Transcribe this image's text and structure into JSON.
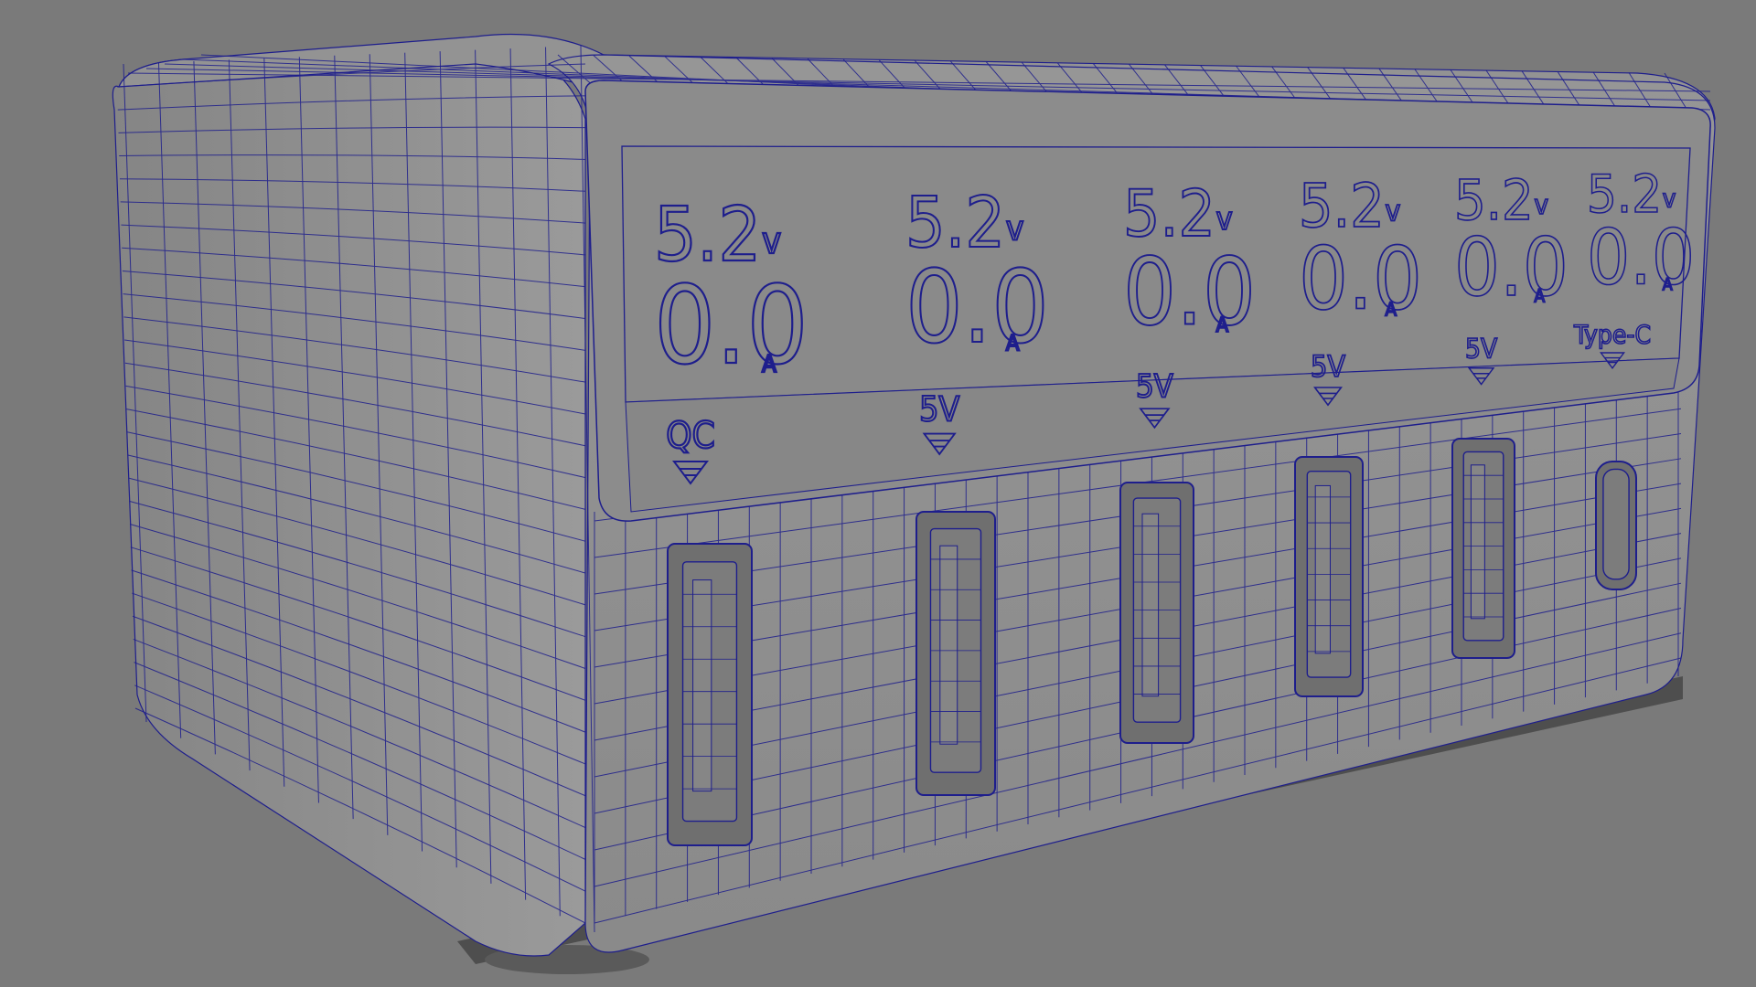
{
  "colors": {
    "background": "#7a7a7a",
    "body": "#8f8f8f",
    "wire": "#1e1e8c",
    "display": "#8a8a8a",
    "port": "#6f6f6f"
  },
  "channels": [
    {
      "voltage": "5.2",
      "voltage_unit": "v",
      "current": "0.0",
      "current_unit": "A",
      "label": "QC"
    },
    {
      "voltage": "5.2",
      "voltage_unit": "v",
      "current": "0.0",
      "current_unit": "A",
      "label": "5V"
    },
    {
      "voltage": "5.2",
      "voltage_unit": "v",
      "current": "0.0",
      "current_unit": "A",
      "label": "5V"
    },
    {
      "voltage": "5.2",
      "voltage_unit": "v",
      "current": "0.0",
      "current_unit": "A",
      "label": "5V"
    },
    {
      "voltage": "5.2",
      "voltage_unit": "v",
      "current": "0.0",
      "current_unit": "A",
      "label": "5V"
    },
    {
      "voltage": "5.2",
      "voltage_unit": "v",
      "current": "0.0",
      "current_unit": "A",
      "label": "Type-C"
    }
  ],
  "ports": [
    "usb-a-qc",
    "usb-a",
    "usb-a",
    "usb-a",
    "usb-a",
    "usb-c"
  ]
}
